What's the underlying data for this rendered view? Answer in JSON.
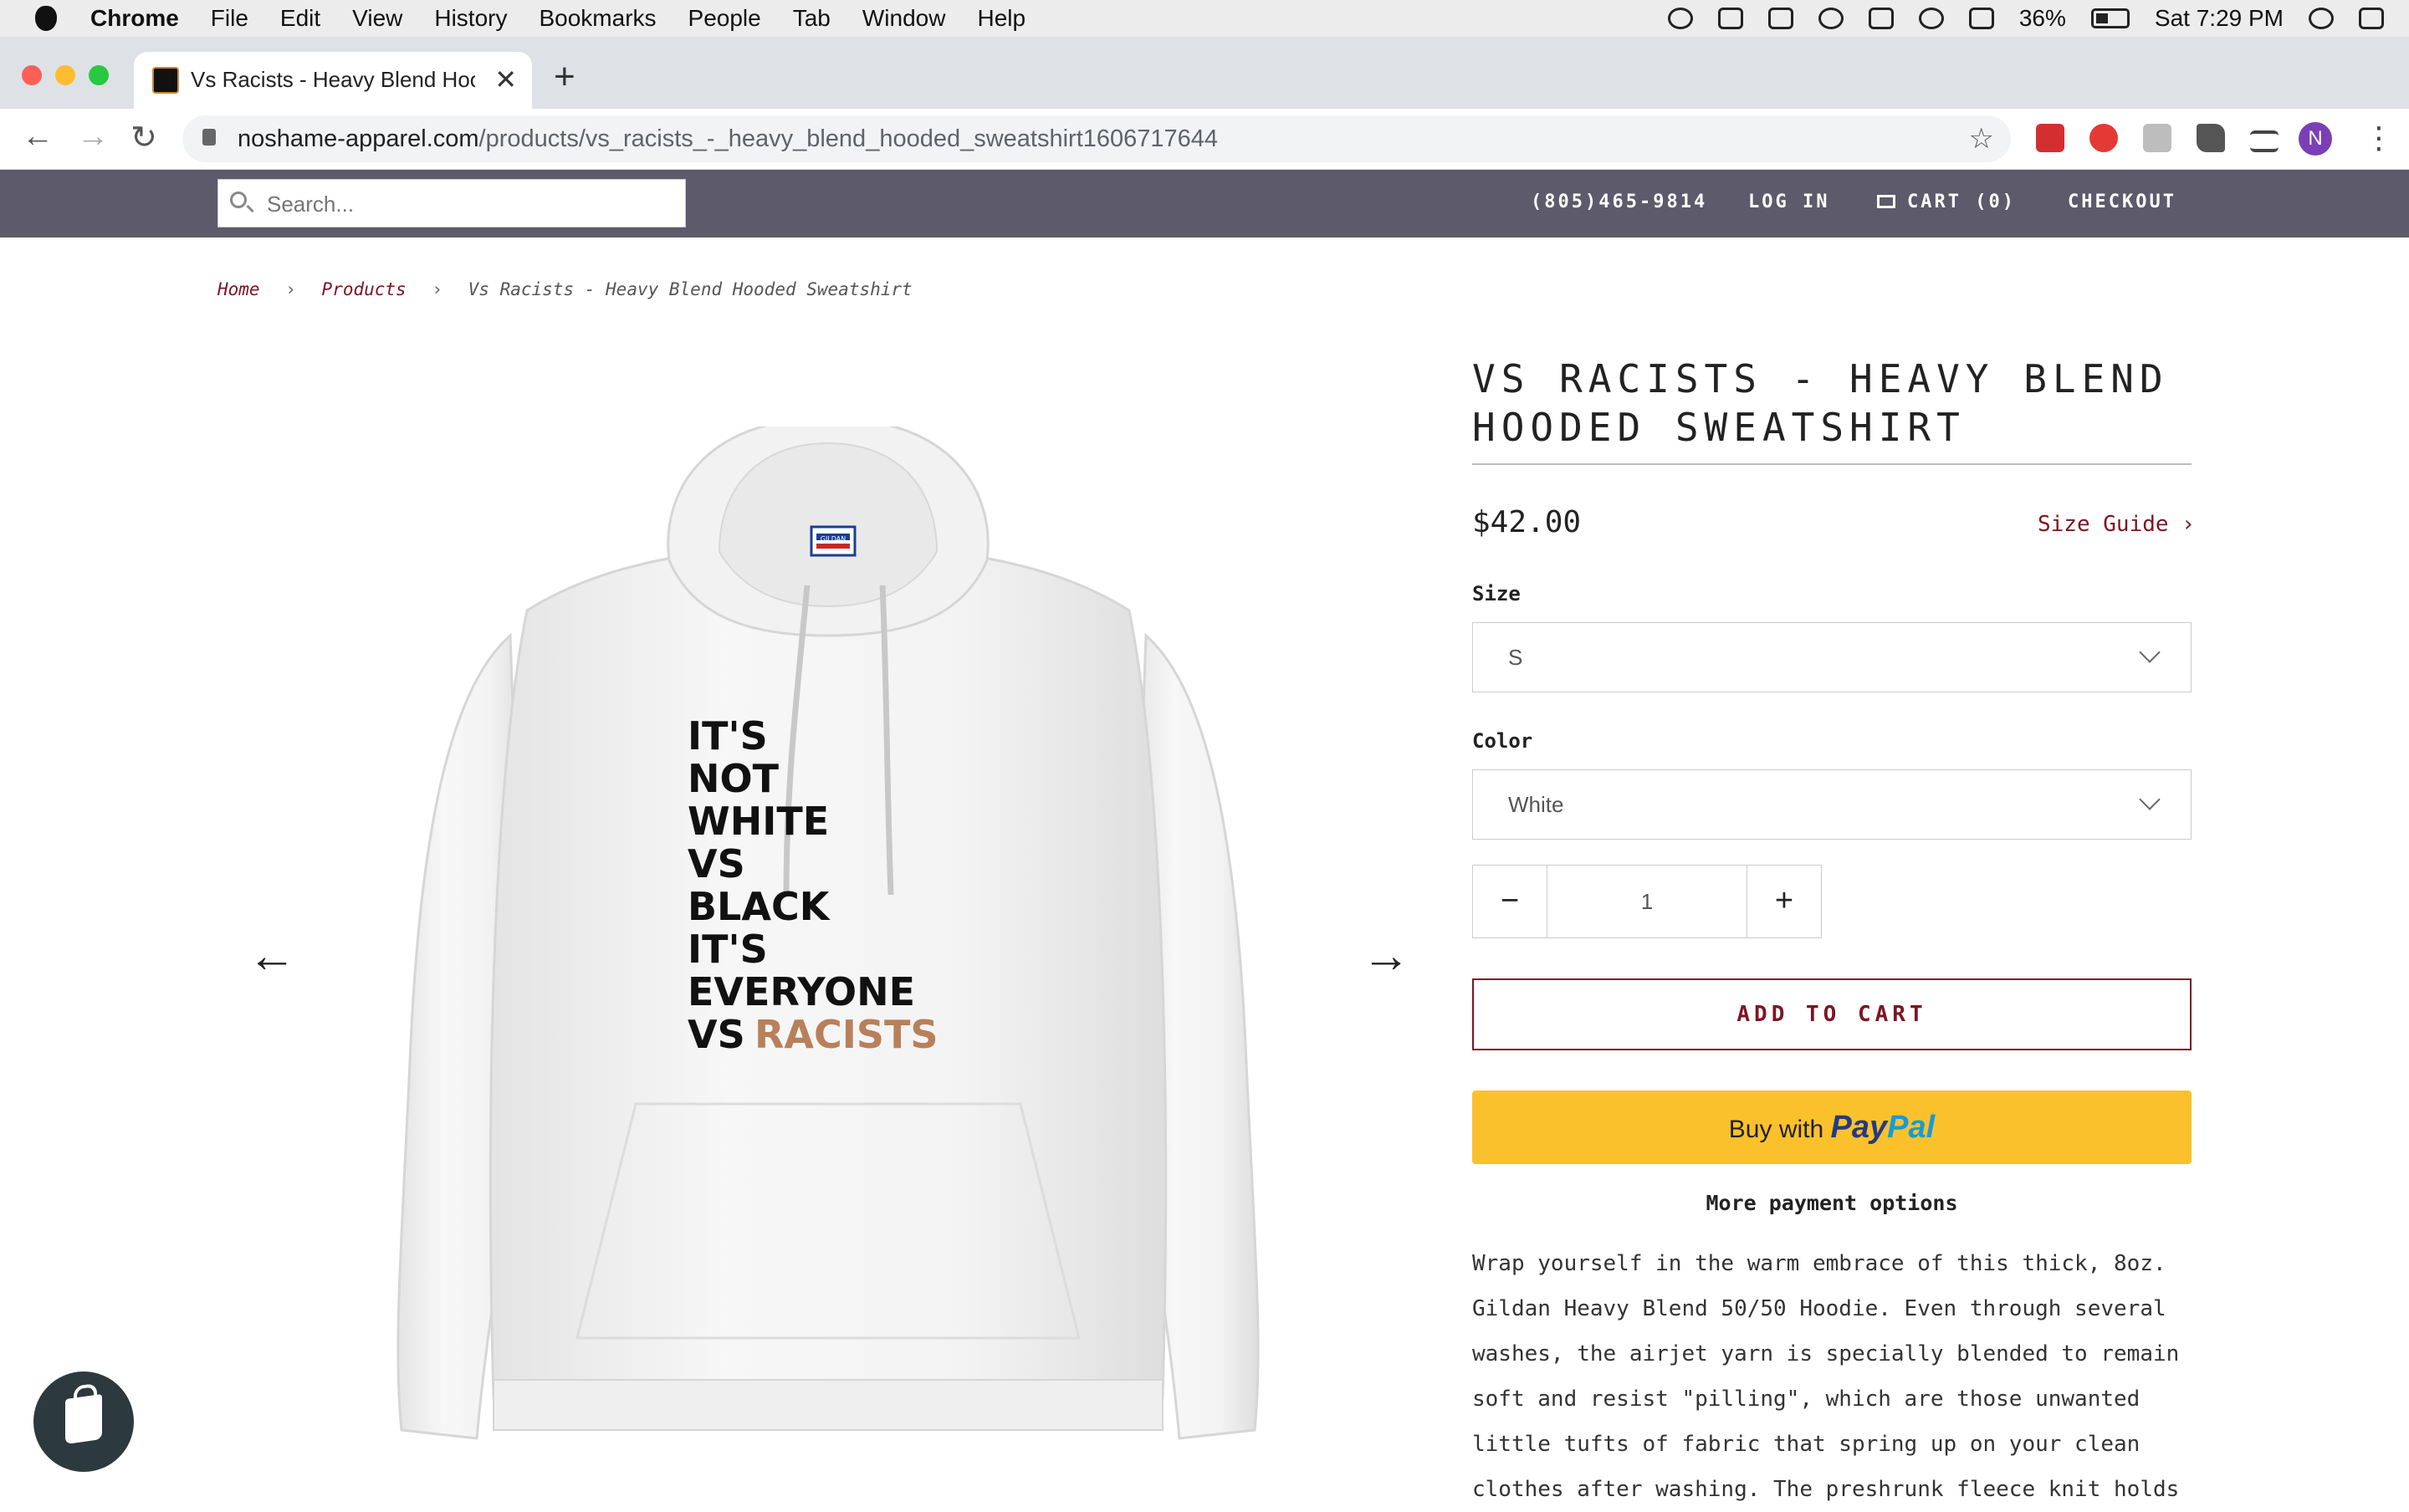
{
  "menubar": {
    "app": "Chrome",
    "items": [
      "File",
      "Edit",
      "View",
      "History",
      "Bookmarks",
      "People",
      "Tab",
      "Window",
      "Help"
    ],
    "battery": "36%",
    "clock": "Sat 7:29 PM"
  },
  "browser": {
    "tab_title": "Vs Racists - Heavy Blend Hooded Sweatshirt",
    "tab_close": "✕",
    "new_tab": "+",
    "url_domain": "noshame-apparel.com",
    "url_path": "/products/vs_racists_-_heavy_blend_hooded_sweatshirt1606717644",
    "profile_initial": "N",
    "accent": "#7b3fb5"
  },
  "site": {
    "search_placeholder": "Search...",
    "phone": "(805)465-9814",
    "login": "LOG IN",
    "cart": "CART (0)",
    "checkout": "CHECKOUT",
    "header_color": "#5c5a6b",
    "accent": "#7d1423"
  },
  "breadcrumb": {
    "home": "Home",
    "products": "Products",
    "current": "Vs Racists - Heavy Blend Hooded Sweatshirt",
    "separator": "›"
  },
  "product": {
    "title": "VS RACISTS - HEAVY BLEND HOODED SWEATSHIRT",
    "price": "$42.00",
    "size_guide": "Size Guide ›",
    "size_label": "Size",
    "size_value": "S",
    "color_label": "Color",
    "color_value": "White",
    "quantity": "1",
    "qty_minus": "−",
    "qty_plus": "+",
    "add_to_cart": "ADD TO CART",
    "paypal_prefix": "Buy with",
    "paypal_brand_1": "Pay",
    "paypal_brand_2": "Pal",
    "more_payment": "More payment options",
    "description": "Wrap yourself in the warm embrace of this thick, 8oz. Gildan Heavy Blend 50/50 Hoodie. Even through several washes, the airjet yarn is specially blended to remain soft and resist \"pilling\", which are those unwanted little tufts of fabric that spring up on your clean clothes after washing. The preshrunk fleece knit holds",
    "image_label": "GILDAN",
    "image_text": [
      "IT'S",
      "NOT",
      "WHITE",
      "VS",
      "BLACK",
      "IT'S",
      "EVERYONE",
      "VS"
    ],
    "image_text_highlight": "RACISTS",
    "prev_arrow": "←",
    "next_arrow": "→"
  }
}
